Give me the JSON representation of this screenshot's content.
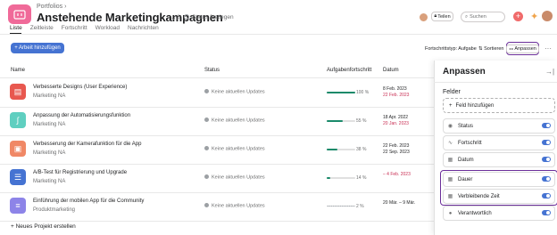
{
  "header": {
    "breadcrumb": "Portfolios",
    "title": "Anstehende Marketingkampagnen",
    "status_label": "Status festlegen",
    "share_label": "Teilen",
    "search_placeholder": "Suchen"
  },
  "tabs": [
    {
      "label": "Liste",
      "active": true
    },
    {
      "label": "Zeitleiste",
      "active": false
    },
    {
      "label": "Fortschritt",
      "active": false
    },
    {
      "label": "Workload",
      "active": false
    },
    {
      "label": "Nachrichten",
      "active": false
    }
  ],
  "toolbar": {
    "add_work_label": "+ Arbeit hinzufügen",
    "progress_type_label": "Fortschrittstyp: Aufgabe",
    "sort_label": "Sortieren",
    "customize_label": "Anpassen"
  },
  "table": {
    "headers": {
      "name": "Name",
      "status": "Status",
      "progress": "Aufgabenfortschritt",
      "date": "Datum"
    },
    "rows": [
      {
        "name": "Verbesserte Designs (User Experience)",
        "team": "Marketing NA",
        "status": "Keine aktuellen Updates",
        "progress_pct": "100 %",
        "progress": 1.0,
        "date_start": "8 Feb. 2023",
        "date_end": "22 Feb. 2023",
        "overdue": true,
        "icon": "document-icon",
        "color": "#e8584f"
      },
      {
        "name": "Anpassung der Automatisierungsfunktion",
        "team": "Marketing NA",
        "status": "Keine aktuellen Updates",
        "progress_pct": "55 %",
        "progress": 0.55,
        "date_start": "18 Apr. 2022",
        "date_end": "20 Jan. 2023",
        "overdue": true,
        "icon": "curve-icon",
        "color": "#5fcfc0"
      },
      {
        "name": "Verbesserung der Kamerafunktion für die App",
        "team": "Marketing NA",
        "status": "Keine aktuellen Updates",
        "progress_pct": "38 %",
        "progress": 0.38,
        "date_start": "22 Feb. 2023",
        "date_end": "22 Sep. 2023",
        "overdue": false,
        "icon": "briefcase-icon",
        "color": "#f08866"
      },
      {
        "name": "A/B-Test für Registrierung und Upgrade",
        "team": "Marketing NA",
        "status": "Keine aktuellen Updates",
        "progress_pct": "14 %",
        "progress": 0.14,
        "date_start": "",
        "date_end": "– 4 Feb. 2023",
        "overdue": true,
        "icon": "list-icon",
        "color": "#4573d2"
      },
      {
        "name": "Einführung der mobilen App für die Community",
        "team": "Produktmarketing",
        "status": "Keine aktuellen Updates",
        "progress_pct": "2 %",
        "progress": 0.02,
        "date_start": "",
        "date_end": "20 Mär. – 9 Mär.",
        "overdue": false,
        "icon": "menu-icon",
        "color": "#8d84e8"
      }
    ],
    "new_project_label": "+ Neues Projekt erstellen"
  },
  "panel": {
    "title": "Anpassen",
    "fields_heading": "Felder",
    "add_field_label": "Feld hinzufügen",
    "fields": [
      {
        "label": "Status",
        "icon": "status-icon",
        "on": true
      },
      {
        "label": "Fortschritt",
        "icon": "progress-icon",
        "on": true
      },
      {
        "label": "Datum",
        "icon": "calendar-icon",
        "on": true
      },
      {
        "label": "Dauer",
        "icon": "calendar-icon",
        "on": true
      },
      {
        "label": "Verbleibende Zeit",
        "icon": "calendar-icon",
        "on": true
      },
      {
        "label": "Verantwortlich",
        "icon": "person-icon",
        "on": true
      }
    ]
  },
  "colors": {
    "accent": "#4573d2",
    "progress": "#1a8a6a",
    "highlight": "#6b2f9a",
    "overdue": "#c92f54"
  }
}
